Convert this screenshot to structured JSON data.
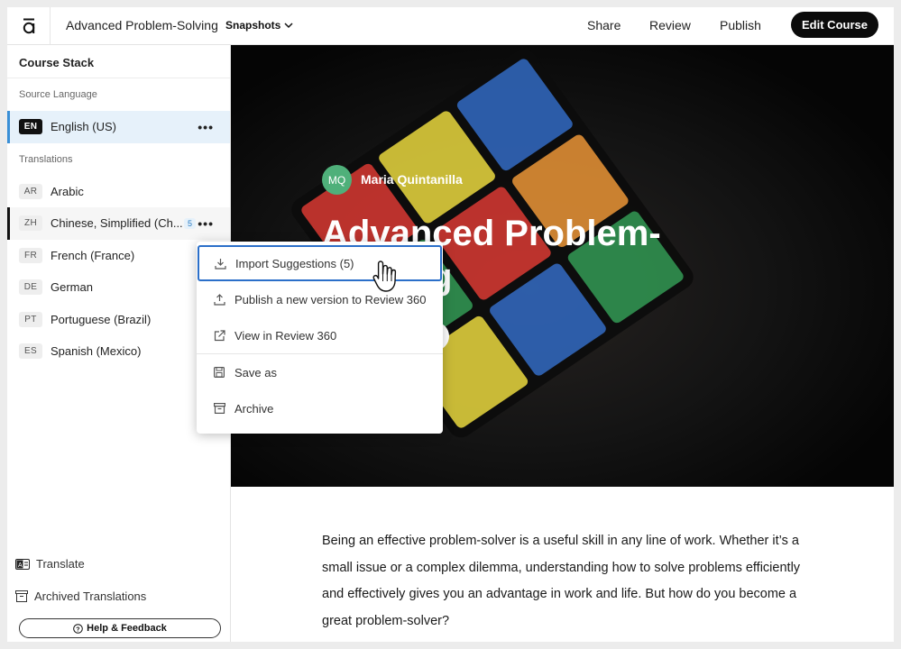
{
  "header": {
    "course_title": "Advanced Problem-Solving",
    "snapshots_label": "Snapshots",
    "share_label": "Share",
    "review_label": "Review",
    "publish_label": "Publish",
    "edit_course_label": "Edit Course"
  },
  "sidebar": {
    "title": "Course Stack",
    "source_section": "Source Language",
    "source": {
      "code": "EN",
      "name": "English (US)",
      "more": "•••"
    },
    "translations_section": "Translations",
    "translations": [
      {
        "code": "AR",
        "name": "Arabic"
      },
      {
        "code": "ZH",
        "name": "Chinese, Simplified (Ch...",
        "badge": "5",
        "more": "•••"
      },
      {
        "code": "FR",
        "name": "French (France)"
      },
      {
        "code": "DE",
        "name": "German"
      },
      {
        "code": "PT",
        "name": "Portuguese (Brazil)"
      },
      {
        "code": "ES",
        "name": "Spanish (Mexico)"
      }
    ],
    "translate_label": "Translate",
    "archived_label": "Archived Translations",
    "help_label": "Help & Feedback"
  },
  "hero": {
    "avatar_initials": "MQ",
    "author": "Maria Quintanilla",
    "title": "Advanced Problem-Solving"
  },
  "article": {
    "paragraph": "Being an effective problem-solver is a useful skill in any line of work. Whether it’s a small issue or a complex dilemma, understanding how to solve problems efficiently and effectively gives you an advantage in work and life. But how do you become a great problem-solver?"
  },
  "context_menu": {
    "items": [
      {
        "label": "Import Suggestions (5)",
        "icon": "download-icon"
      },
      {
        "label": "Publish a new version to Review 360",
        "icon": "upload-icon"
      },
      {
        "label": "View in Review 360",
        "icon": "external-link-icon"
      },
      {
        "label": "Save as",
        "icon": "save-icon"
      },
      {
        "label": "Archive",
        "icon": "archive-icon"
      }
    ]
  },
  "colors": {
    "accent_blue": "#3a8fd6",
    "active_row_bg": "#e6f1fa",
    "avatar_green": "#4fb07a",
    "button_dark": "#0b0b0b"
  }
}
